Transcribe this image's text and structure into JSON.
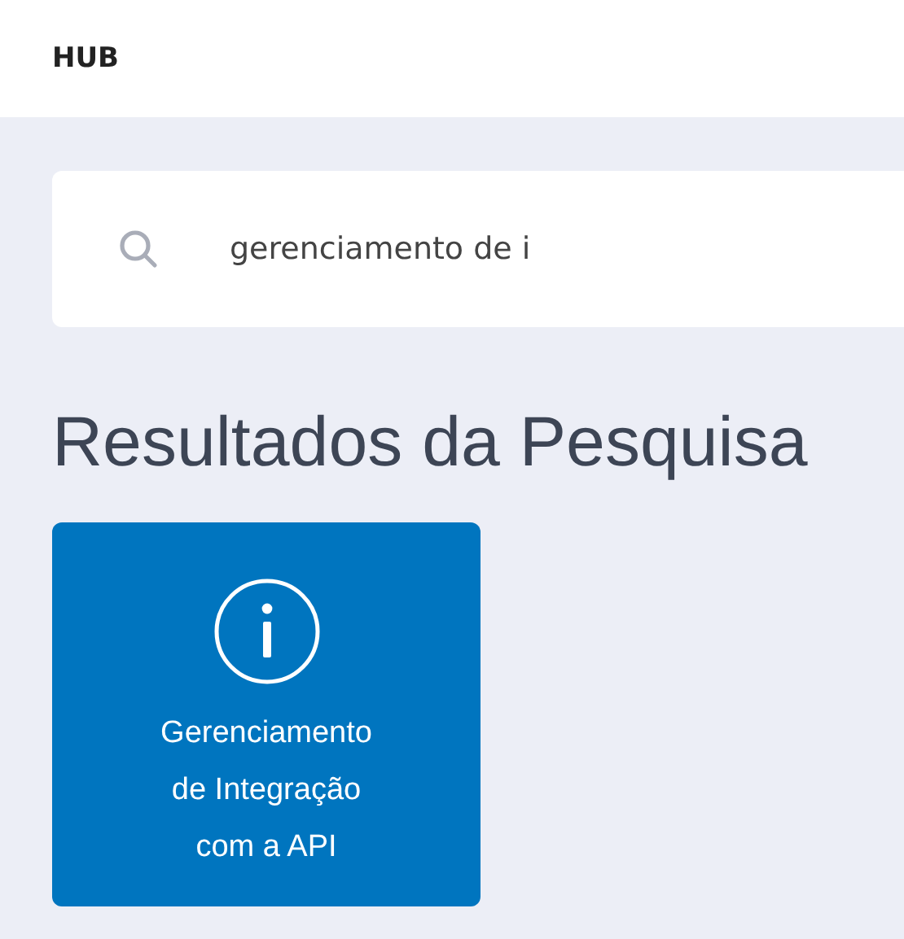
{
  "header": {
    "title": "HUB"
  },
  "search": {
    "value": "gerenciamento de i"
  },
  "results": {
    "heading": "Resultados da Pesquisa",
    "cards": [
      {
        "kind": "info",
        "label": "Gerenciamento de Integração com a API"
      }
    ]
  }
}
